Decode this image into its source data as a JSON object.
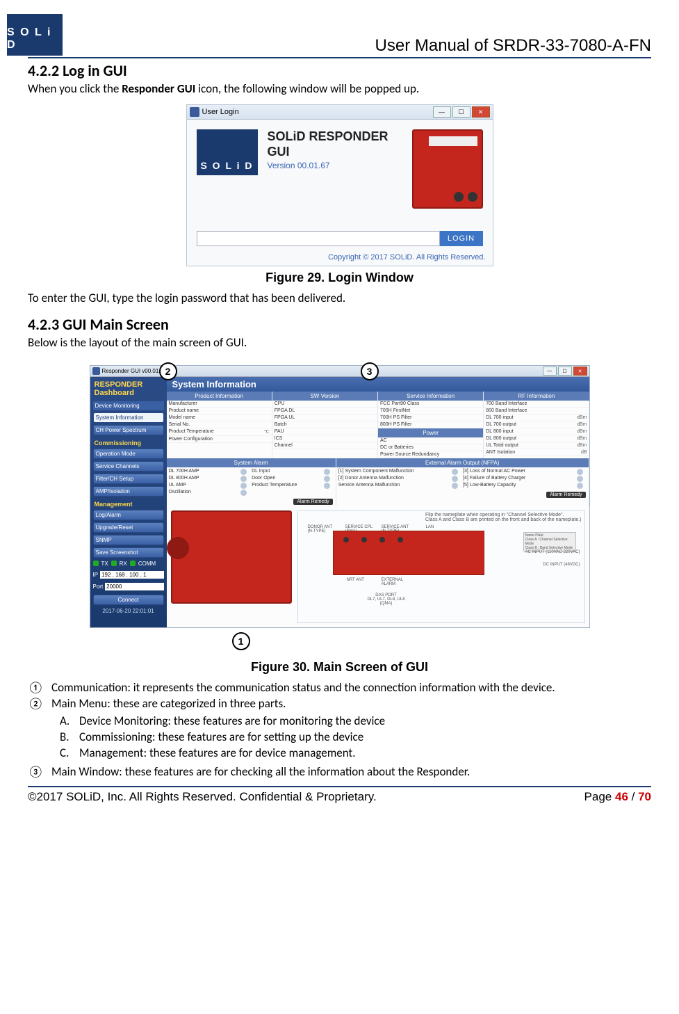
{
  "logo_text": "S O L i D",
  "doc_title": "User Manual of SRDR-33-7080-A-FN",
  "section_422_heading": "4.2.2 Log in GUI",
  "section_422_intro_a": "When you click the ",
  "section_422_intro_b": "Responder GUI",
  "section_422_intro_c": " icon, the following window will be popped up.",
  "login_window": {
    "title": "User Login",
    "product": "SOLiD RESPONDER GUI",
    "version": "Version 00.01.67",
    "login_label": "LOGIN",
    "copyright": "Copyright © 2017 SOLiD. All Rights Reserved."
  },
  "fig29_caption": "Figure 29. Login Window",
  "section_422_after": "To enter the GUI, type the login password that has been delivered.",
  "section_423_heading": "4.2.3 GUI Main Screen",
  "section_423_intro": "Below is the layout of the main screen of GUI.",
  "callouts": {
    "c1": "①",
    "c2": "②",
    "c3": "③",
    "n1": "1",
    "n2": "2",
    "n3": "3"
  },
  "main_window": {
    "title": "Responder GUI v00.01.72",
    "side_title": "RESPONDER\nDashboard",
    "groups": {
      "device_monitoring": "Device Monitoring",
      "commissioning": "Commissioning",
      "management": "Management"
    },
    "buttons": {
      "sys_info": "System Information",
      "ch_power": "CH Power Spectrum",
      "op_mode": "Operation Mode",
      "svc_ch": "Service Channels",
      "filter": "Filter/CH Setup",
      "amp": "AMP/Isolation",
      "log": "Log/Alarm",
      "upg": "Upgrade/Reset",
      "snmp": "SNMP",
      "save": "Save Screenshot",
      "connect": "Connect"
    },
    "led": {
      "tx": "TX",
      "rx": "RX",
      "comm": "COMM"
    },
    "ip_label": "IP",
    "ip": "192 . 168 . 100 .   1",
    "port_label": "Port",
    "port": "20000",
    "timestamp": "2017-06-20 22:01:01",
    "content_title": "System Information",
    "panels": {
      "prod": {
        "h": "Product Information",
        "rows": [
          "Manufacturer",
          "Product name",
          "Model name",
          "Serial No.",
          "Product Temperature",
          "Power Configuration"
        ],
        "unit": "℃"
      },
      "sw": {
        "h": "SW Version",
        "rows": [
          "CPU",
          "FPGA DL",
          "FPGA UL",
          "Batch",
          "PAU",
          "",
          "ICS",
          "Channel"
        ]
      },
      "svc": {
        "h": "Service Information",
        "rows": [
          "FCC Part90 Class",
          "700H FirstNet",
          "700H PS Filter",
          "800H PS Filter"
        ]
      },
      "power": {
        "h": "Power",
        "rows": [
          "AC",
          "DC or Batteries",
          "Power Source Redundancy"
        ]
      },
      "rf": {
        "h": "RF Information",
        "rows": [
          "700 Band Interface",
          "800 Band Interface",
          "DL 700 input",
          "DL 700 output",
          "DL 800 input",
          "DL 800 output",
          "UL Total output",
          "ANT Isolation"
        ],
        "units": [
          "",
          "",
          "dBm",
          "dBm",
          "dBm",
          "dBm",
          "dBm",
          "dB"
        ]
      }
    },
    "sys_alarm": {
      "h": "System Alarm",
      "rows": [
        [
          "DL 700H AMP",
          "DL Input"
        ],
        [
          "DL 800H AMP",
          "Door Open"
        ],
        [
          "UL AMP",
          "Product Temperature"
        ],
        [
          "Oscillation",
          ""
        ]
      ],
      "remedy": "Alarm Remedy"
    },
    "ext_alarm": {
      "h": "External Alarm Output (NFPA)",
      "rows": [
        [
          "[1] System Component Malfunction",
          "[3] Loss of Normal AC Power"
        ],
        [
          "[2] Donor Antenna Malfunction",
          "[4] Failure of Battery Charger"
        ],
        [
          "Service Antenna Malfunction",
          "[5] Low-Battery Capacity"
        ]
      ],
      "remedy": "Alarm Remedy"
    },
    "schematic": {
      "note": "Flip the nameplate when operating in \"Channel Selective Mode\".\nClass A and Class B are printed on the front and back of the nameplate.)",
      "plate": [
        "Name Plate",
        "Class A : Channel Selective Mode",
        "Class B : Band Selective Mode"
      ],
      "labels": {
        "donor": "DONOR ANT\n(N-TYPE)",
        "svc_cpl": "SERVICE CPL\n(SMA)",
        "svc_ant": "SERVICE ANT\n(N-TYPE)",
        "lan": "LAN",
        "ac": "AC INPUT (110VAC-220VAC)",
        "dc": "DC INPUT (48VDC)",
        "nrt": "NRT ANT",
        "ext": "EXTERNAL\nALARM",
        "das": "DAS PORT\nDL7, UL7, DL8, UL8\n(QMA)"
      }
    }
  },
  "fig30_caption": "Figure 30. Main Screen of GUI",
  "list": {
    "i1": "Communication: it represents the communication status and the connection information with the device.",
    "i2": "Main Menu: these are categorized in three parts.",
    "i2a": "Device Monitoring: these features are for monitoring the device",
    "i2b": "Commissioning: these features are for setting up the device",
    "i2c": "Management: these features are for device management.",
    "i3": "Main Window: these features are for checking all the information about the Responder."
  },
  "footer": {
    "left": "©2017 SOLiD, Inc. All Rights Reserved. Confidential & Proprietary.",
    "page_label": "Page ",
    "cur": "46",
    "sep": " / ",
    "total": "70"
  }
}
